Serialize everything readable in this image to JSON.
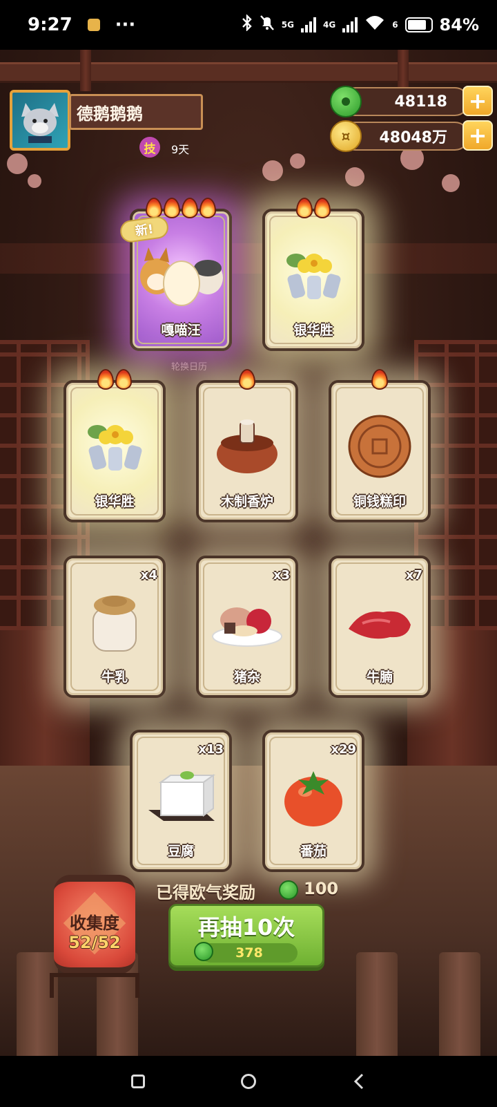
{
  "status_bar": {
    "time": "9:27",
    "dots": "···",
    "network_1": "5G",
    "network_2": "4G",
    "wifi_badge": "6",
    "battery": "84%",
    "battery_level": 0.84
  },
  "player": {
    "name": "德鹅鹅鹅",
    "skill_badge": "技",
    "days": "9天"
  },
  "currencies": {
    "jade": "48118",
    "coins": "48048万",
    "coin_icon_glyph": "¤",
    "plus_label": "+"
  },
  "calendar_caption": "轮换日历",
  "cards": [
    {
      "name": "嘎喵汪",
      "qty": "",
      "flames": 4,
      "new_label": "新!",
      "style": "purple"
    },
    {
      "name": "银华胜",
      "qty": "",
      "flames": 2,
      "style": "yellowfx"
    },
    {
      "name": "银华胜",
      "qty": "",
      "flames": 2,
      "style": "yellowfx"
    },
    {
      "name": "木制香炉",
      "qty": "",
      "flames": 1,
      "style": "glow"
    },
    {
      "name": "铜钱糕印",
      "qty": "",
      "flames": 1,
      "style": "glow"
    },
    {
      "name": "牛乳",
      "qty": "x4",
      "flames": 0,
      "style": "glow"
    },
    {
      "name": "猪杂",
      "qty": "x3",
      "flames": 0,
      "style": "glow"
    },
    {
      "name": "牛腩",
      "qty": "x7",
      "flames": 0,
      "style": "glow"
    },
    {
      "name": "豆腐",
      "qty": "x13",
      "flames": 0,
      "style": "glow"
    },
    {
      "name": "番茄",
      "qty": "x29",
      "flames": 0,
      "style": "glow"
    }
  ],
  "reward": {
    "label": "已得欧气奖励",
    "value": "100"
  },
  "redraw": {
    "label": "再抽10次",
    "cost": "378"
  },
  "collection": {
    "label": "收集度",
    "value": "52/52"
  },
  "colors": {
    "accent_gold": "#e6a23c",
    "button_green": "#6fb132",
    "lantern_red": "#d9493a"
  }
}
